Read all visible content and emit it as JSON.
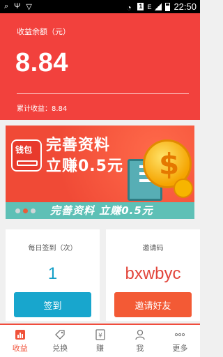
{
  "statusbar": {
    "time": "22:50",
    "sim_label": "1",
    "network_label": "E"
  },
  "hero": {
    "label": "收益余额（元）",
    "amount": "8.84",
    "total_text": "累计收益：8.84",
    "bg_color": "#f2413d"
  },
  "banner": {
    "title_line1": "完善资料",
    "title_line2": "立赚0.5元",
    "wallet_label": "钱包",
    "caption": "完善资料 立赚0.5元",
    "dot_count": 3,
    "active_dot": 1
  },
  "cards": {
    "signin": {
      "title": "每日签到（次）",
      "value": "1",
      "button": "签到",
      "color": "#18a6cd"
    },
    "invite": {
      "title": "邀请码",
      "value": "bxwbyc",
      "button": "邀请好友",
      "color": "#f35a35"
    }
  },
  "tabs": [
    {
      "label": "收益",
      "icon": "bar-chart-icon",
      "active": true
    },
    {
      "label": "兑换",
      "icon": "tag-icon",
      "active": false
    },
    {
      "label": "赚",
      "icon": "money-icon",
      "active": false
    },
    {
      "label": "我",
      "icon": "user-icon",
      "active": false
    },
    {
      "label": "更多",
      "icon": "more-icon",
      "active": false
    }
  ]
}
